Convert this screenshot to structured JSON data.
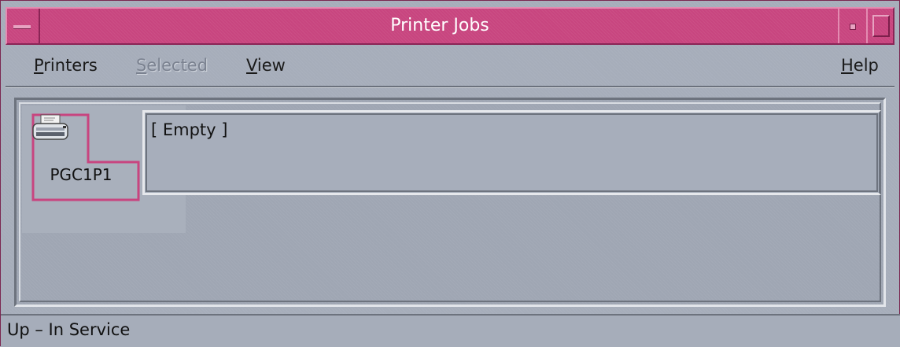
{
  "window": {
    "title": "Printer Jobs"
  },
  "menubar": {
    "printers": {
      "underline": "P",
      "rest": "rinters"
    },
    "selected": {
      "underline": "S",
      "rest": "elected",
      "enabled": false
    },
    "view": {
      "underline": "V",
      "rest": "iew"
    },
    "help": {
      "underline": "H",
      "rest": "elp"
    }
  },
  "printer": {
    "name": "PGC1P1",
    "icon": "printer-icon"
  },
  "jobs": {
    "text": "[ Empty ]"
  },
  "status": {
    "text": "Up – In Service"
  },
  "colors": {
    "titlebar": "#c8457f",
    "selection_outline": "#c8457f",
    "background": "#a6adba"
  }
}
